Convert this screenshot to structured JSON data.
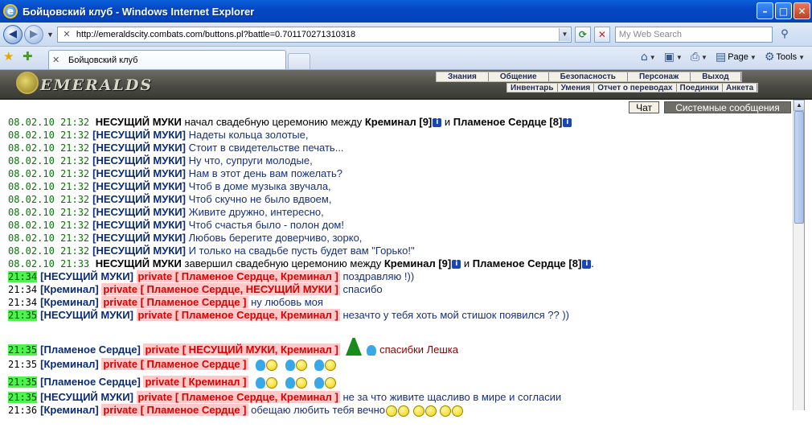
{
  "window": {
    "title": "Бойцовский клуб - Windows Internet Explorer"
  },
  "address_bar": {
    "url": "http://emeraldscity.combats.com/buttons.pl?battle=0.701170271310318",
    "search_placeholder": "My Web Search"
  },
  "tab": {
    "label": "Бойцовский клуб"
  },
  "command_bar": {
    "page_label": "Page",
    "tools_label": "Tools"
  },
  "site": {
    "logo_text": "EMERALDS",
    "top_menu": [
      "Знания",
      "Общение",
      "Безопасность",
      "Персонаж",
      "Выход"
    ],
    "sub_menu": [
      "Инвентарь",
      "Умения",
      "Отчет о переводах",
      "Поединки",
      "Анкета"
    ]
  },
  "chat": {
    "tabs": [
      {
        "label": "Чат",
        "active": true
      },
      {
        "label": "Системные сообщения",
        "active": false
      }
    ],
    "system_open": {
      "ts": "08.02.10 21:32",
      "nick": "НЕСУЩИЙ МУКИ",
      "text_a": "начал свадебную церемонию между",
      "p1": "Креминал [9]",
      "and": "и",
      "p2": "Пламеное Сердце [8]"
    },
    "poem": [
      {
        "ts": "08.02.10 21:32",
        "nick": "НЕСУЩИЙ МУКИ",
        "text": "Надеты кольца золотые,"
      },
      {
        "ts": "08.02.10 21:32",
        "nick": "НЕСУЩИЙ МУКИ",
        "text": "Стоит в свидетельстве печать..."
      },
      {
        "ts": "08.02.10 21:32",
        "nick": "НЕСУЩИЙ МУКИ",
        "text": "Ну что, супруги молодые,"
      },
      {
        "ts": "08.02.10 21:32",
        "nick": "НЕСУЩИЙ МУКИ",
        "text": "Нам в этот день вам пожелать?"
      },
      {
        "ts": "08.02.10 21:32",
        "nick": "НЕСУЩИЙ МУКИ",
        "text": "Чтоб в доме музыка звучала,"
      },
      {
        "ts": "08.02.10 21:32",
        "nick": "НЕСУЩИЙ МУКИ",
        "text": "Чтоб скучно не было вдвоем,"
      },
      {
        "ts": "08.02.10 21:32",
        "nick": "НЕСУЩИЙ МУКИ",
        "text": "Живите дружно, интересно,"
      },
      {
        "ts": "08.02.10 21:32",
        "nick": "НЕСУЩИЙ МУКИ",
        "text": "Чтоб счастья было - полон дом!"
      },
      {
        "ts": "08.02.10 21:32",
        "nick": "НЕСУЩИЙ МУКИ",
        "text": "Любовь берегите доверчиво, зорко,"
      },
      {
        "ts": "08.02.10 21:32",
        "nick": "НЕСУЩИЙ МУКИ",
        "text": "И только на свадьбе пусть будет вам \"Горько!\""
      }
    ],
    "system_close": {
      "ts": "08.02.10 21:33",
      "nick": "НЕСУЩИЙ МУКИ",
      "text_a": "завершил свадебную церемонию между",
      "p1": "Креминал [9]",
      "and": "и",
      "p2": "Пламеное Сердце [8]",
      "end": "."
    },
    "private_label": "private",
    "private_msgs": [
      {
        "ts": "21:34",
        "nick": "НЕСУЩИЙ МУКИ",
        "to": "[ Пламеное Сердце, Креминал ]",
        "text": "поздравляю !))"
      },
      {
        "ts": "21:34",
        "nick": "Креминал",
        "to": "[ Пламеное Сердце, НЕСУЩИЙ МУКИ ]",
        "text": "спасибо"
      },
      {
        "ts": "21:34",
        "nick": "Креминал",
        "to": "[ Пламеное Сердце ]",
        "text": "ну любовь моя"
      },
      {
        "ts": "21:35",
        "nick": "НЕСУЩИЙ МУКИ",
        "to": "[ Пламеное Сердце, Креминал ]",
        "text": "незачто у тебя хоть мой стишок появился ?? ))"
      },
      {
        "ts": "21:35",
        "nick": "Пламеное Сердце",
        "to": "[ НЕСУЩИЙ МУКИ, Креминал ]",
        "text": "спасибки Лешка"
      },
      {
        "ts": "21:35",
        "nick": "Креминал",
        "to": "[ Пламеное Сердце ]",
        "text": ""
      },
      {
        "ts": "21:35",
        "nick": "Пламеное Сердце",
        "to": "[ Креминал ]",
        "text": ""
      },
      {
        "ts": "21:35",
        "nick": "НЕСУЩИЙ МУКИ",
        "to": "[ Пламеное Сердце, Креминал ]",
        "text": "не за что живите щасливо в мире и согласии"
      },
      {
        "ts": "21:36",
        "nick": "Креминал",
        "to": "[ Пламеное Сердце ]",
        "text": "обещаю любить тебя вечно"
      }
    ]
  },
  "colors": {
    "timestamp_green": "#007a00",
    "timestamp_highlight": "#4cf44c",
    "private_red": "#dd0000",
    "nick_blue": "#0a2c78"
  }
}
